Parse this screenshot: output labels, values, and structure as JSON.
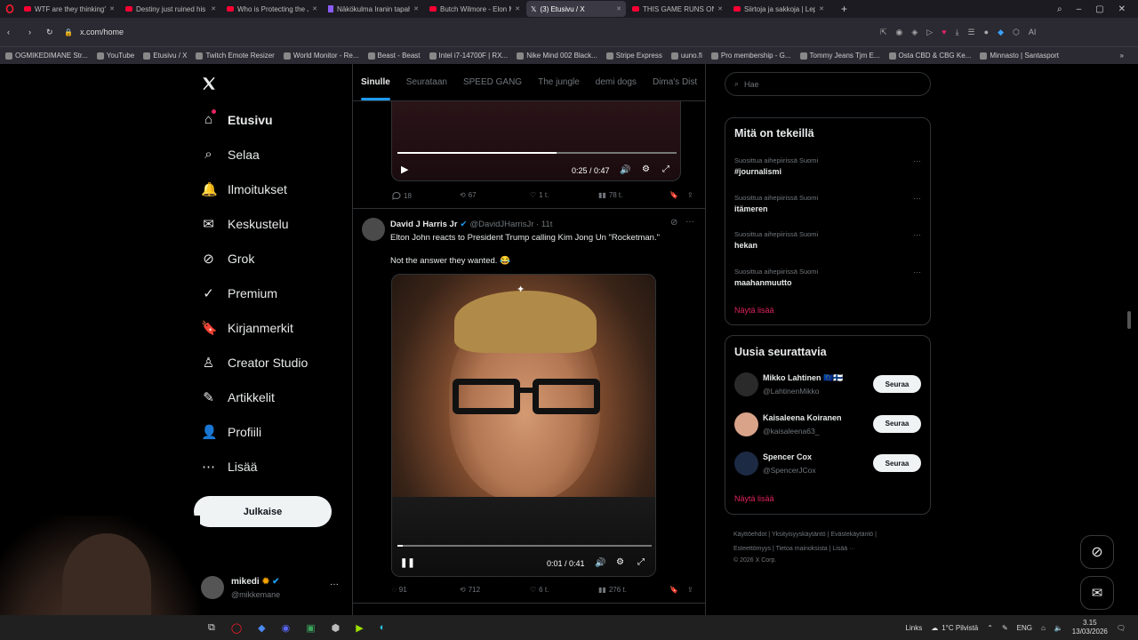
{
  "browser": {
    "tabs": [
      {
        "label": "WTF are they thinking? - Y",
        "kind": "yt"
      },
      {
        "label": "Destiny just ruined his car",
        "kind": "yt"
      },
      {
        "label": "Who is Protecting the Jeffr",
        "kind": "yt"
      },
      {
        "label": "Näkökulma Iranin tapahtu",
        "kind": "purp"
      },
      {
        "label": "Butch Wilmore - Elon Mu",
        "kind": "yt"
      },
      {
        "label": "(3) Etusivu / X",
        "kind": "x",
        "active": true
      },
      {
        "label": "THIS GAME RUNS ON NIG",
        "kind": "yt"
      },
      {
        "label": "Siirtoja ja sakkoja | Lepaki",
        "kind": "yt"
      }
    ],
    "url": "x.com/home",
    "ai_label": "AI",
    "bookmarks": [
      "OGMIKEDIMANE Str...",
      "YouTube",
      "Etusivu / X",
      "Twitch Emote Resizer",
      "World Monitor - Re...",
      "Beast - Beast",
      "Intel i7-14700F | RX...",
      "Nike Mind 002 Black...",
      "Stripe Express",
      "uuno.fi",
      "Pro membership - G...",
      "Tommy Jeans Tjm E...",
      "Osta CBD & CBG Ke...",
      "Minnasto | Santasport"
    ]
  },
  "nav": {
    "items": [
      "Etusivu",
      "Selaa",
      "Ilmoitukset",
      "Keskustelu",
      "Grok",
      "Premium",
      "Kirjanmerkit",
      "Creator Studio",
      "Artikkelit",
      "Profiili",
      "Lisää"
    ],
    "post_label": "Julkaise",
    "profile_name": "mikedi",
    "profile_handle": "@mikkemane"
  },
  "center": {
    "tabs": [
      "Sinulle",
      "Seurataan",
      "SPEED GANG",
      "The jungle",
      "demi dogs",
      "Dima's Dist"
    ],
    "video1": {
      "time": "0:25 / 0:47",
      "progress": 0.57
    },
    "post1_stats": {
      "replies": "18",
      "reposts": "67",
      "likes": "1 t.",
      "views": "78 t."
    },
    "post2": {
      "author": "David J Harris Jr",
      "handle_time": "@DavidJHarrisJr · 11t",
      "text1": "Elton John reacts to President Trump calling Kim Jong Un \"Rocketman.\"",
      "text2": "Not the answer they wanted. 😂",
      "video_time": "0:01 / 0:41",
      "video_progress": 0.02,
      "stats": {
        "replies": "91",
        "reposts": "712",
        "likes": "6 t.",
        "views": "276 t."
      }
    }
  },
  "right": {
    "search_placeholder": "Hae",
    "trends_title": "Mitä on tekeillä",
    "trends": [
      {
        "ctx": "Suosittua aihepiirissä Suomi",
        "name": "#journalismi"
      },
      {
        "ctx": "Suosittua aihepiirissä Suomi",
        "name": "itämeren"
      },
      {
        "ctx": "Suosittua aihepiirissä Suomi",
        "name": "hekan"
      },
      {
        "ctx": "Suosittua aihepiirissä Suomi",
        "name": "maahanmuutto"
      }
    ],
    "trends_more": "Näytä lisää",
    "follow_title": "Uusia seurattavia",
    "follows": [
      {
        "name": "Mikko Lahtinen 🇪🇺🇫🇮",
        "handle": "@LahtinenMikko"
      },
      {
        "name": "Kaisaleena Koiranen",
        "handle": "@kaisaleena63_"
      },
      {
        "name": "Spencer Cox",
        "handle": "@SpencerJCox"
      }
    ],
    "follow_label": "Seuraa",
    "follow_more": "Näytä lisää",
    "footer1": "Käyttöehdot  |  Yksityisyyskäytäntö  |  Evästekäytäntö  |",
    "footer2": "Esteettömyys  |  Tietoa mainoksista  |  Lisää ···",
    "footer3": "© 2026 X Corp."
  },
  "taskbar": {
    "links": "Links",
    "weather": "1°C  Pilvistä",
    "lang": "ENG",
    "time": "3.15",
    "date": "13/03/2026"
  },
  "colors": {
    "accent": "#1d9bf0",
    "showmore": "#e0245e"
  }
}
